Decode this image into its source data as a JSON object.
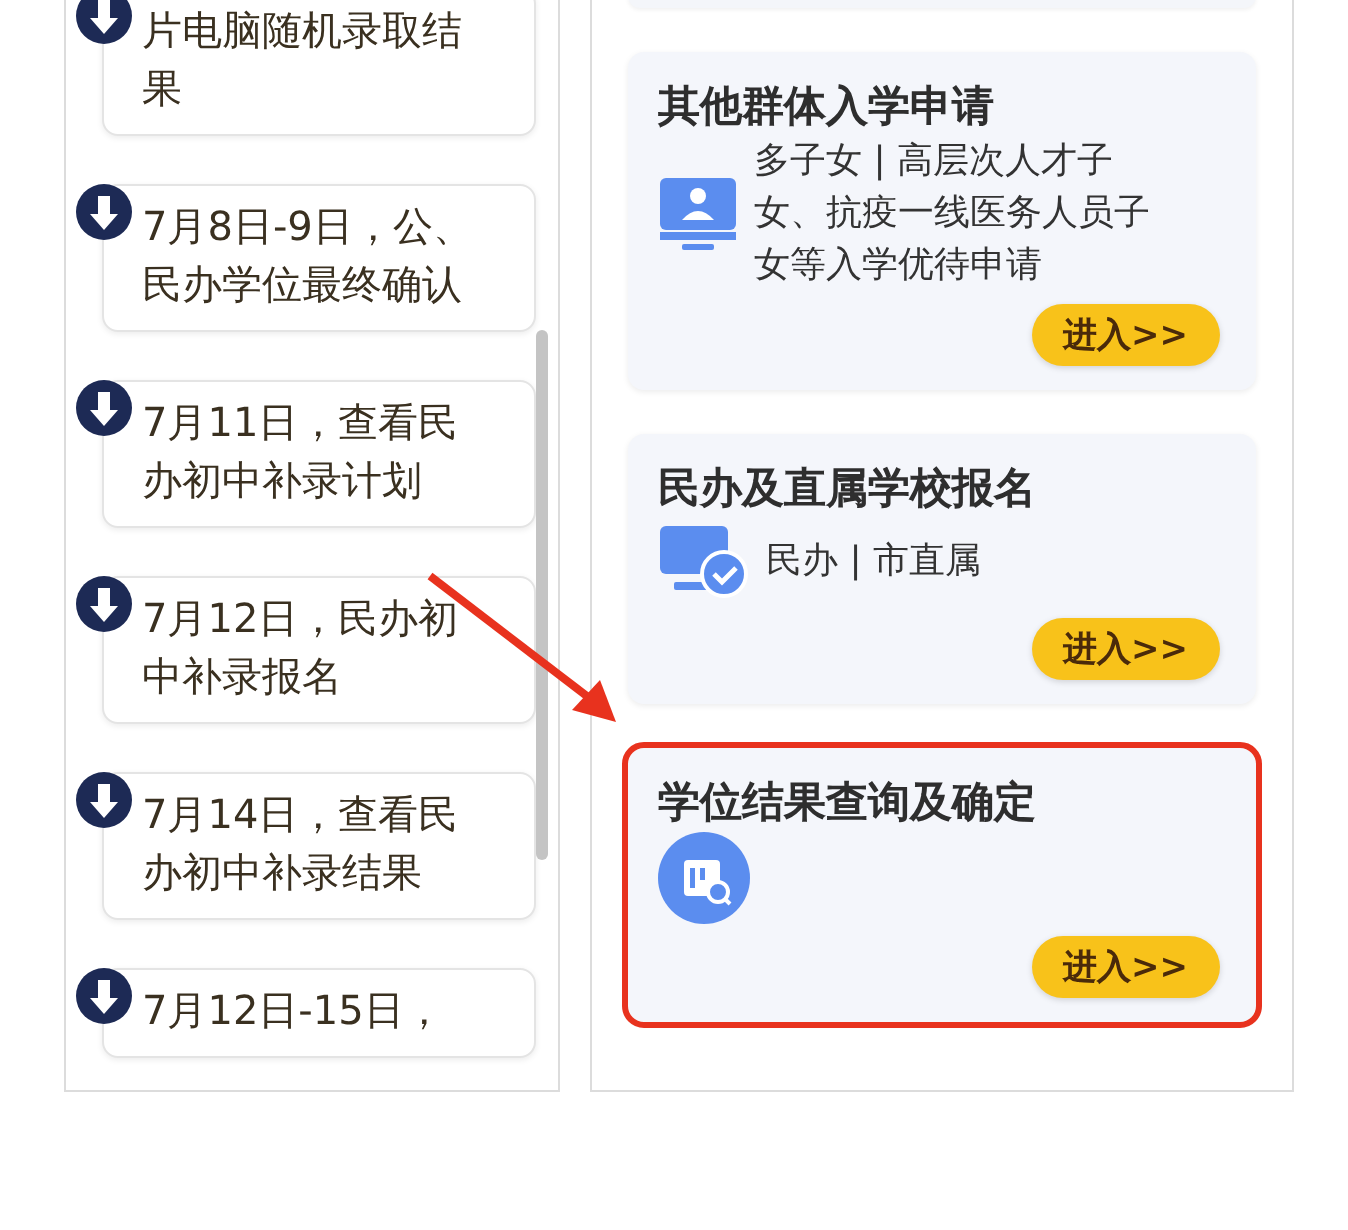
{
  "timeline": [
    {
      "lines": [
        "片电脑随机录取结",
        "果"
      ]
    },
    {
      "lines": [
        "7月8日-9日，公、",
        "民办学位最终确认"
      ]
    },
    {
      "lines": [
        "7月11日，查看民",
        "办初中补录计划"
      ]
    },
    {
      "lines": [
        "7月12日，民办初",
        "中补录报名"
      ]
    },
    {
      "lines": [
        "7月14日，查看民",
        "办初中补录结果"
      ]
    },
    {
      "lines": [
        "7月12日-15日，"
      ]
    }
  ],
  "services": [
    {
      "title": "其他群体入学申请",
      "kind": "monitor-person",
      "description": [
        "多子女 | 高层次人才子",
        "女、抗疫一线医务人员子",
        "女等入学优待申请"
      ],
      "button": "进入>>",
      "highlighted": false
    },
    {
      "title": "民办及直属学校报名",
      "kind": "monitor-check",
      "description": [
        "民办 | 市直属"
      ],
      "button": "进入>>",
      "highlighted": false
    },
    {
      "title": "学位结果查询及确定",
      "kind": "search-document",
      "button": "进入>>",
      "highlighted": true
    }
  ]
}
